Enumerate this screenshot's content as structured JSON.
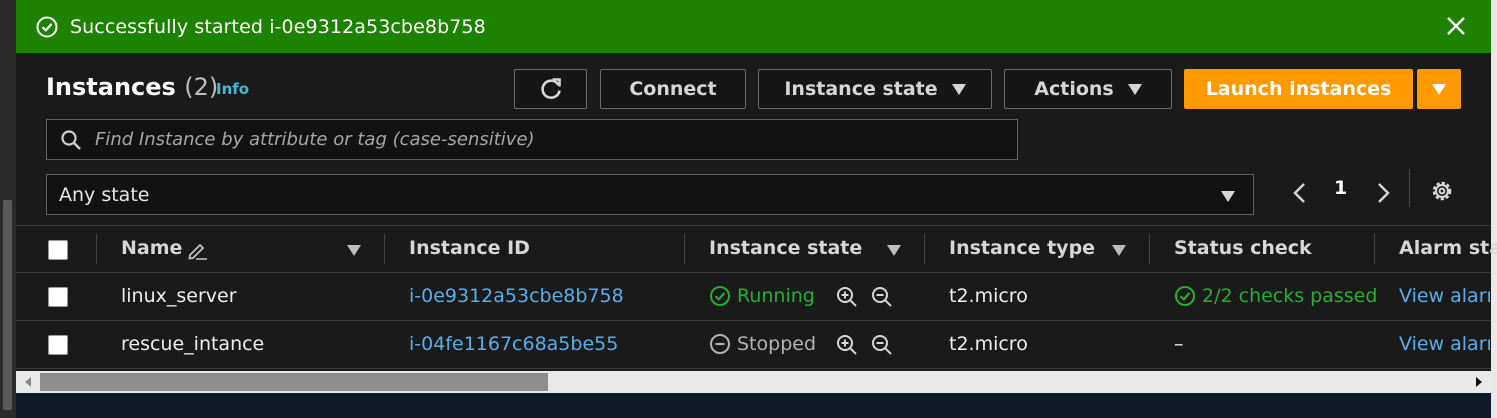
{
  "flash": {
    "message": "Successfully started i-0e9312a53cbe8b758",
    "color": "#1d8102"
  },
  "header": {
    "title": "Instances",
    "count": "(2)",
    "info_link": "Info"
  },
  "toolbar": {
    "connect_label": "Connect",
    "instance_state_label": "Instance state",
    "actions_label": "Actions",
    "launch_label": "Launch instances",
    "launch_color": "#ff9900"
  },
  "search": {
    "placeholder": "Find Instance by attribute or tag (case-sensitive)"
  },
  "filter": {
    "selected": "Any state"
  },
  "pagination": {
    "page": "1"
  },
  "table": {
    "columns": [
      "Name",
      "Instance ID",
      "Instance state",
      "Instance type",
      "Status check",
      "Alarm sta"
    ],
    "rows": [
      {
        "name": "linux_server",
        "instance_id": "i-0e9312a53cbe8b758",
        "state": "Running",
        "instance_type": "t2.micro",
        "status_check": "2/2 checks passed",
        "alarm": "View aları"
      },
      {
        "name": "rescue_intance",
        "instance_id": "i-04fe1167c68a5be55",
        "state": "Stopped",
        "instance_type": "t2.micro",
        "status_check": "–",
        "alarm": "View aları"
      }
    ]
  }
}
